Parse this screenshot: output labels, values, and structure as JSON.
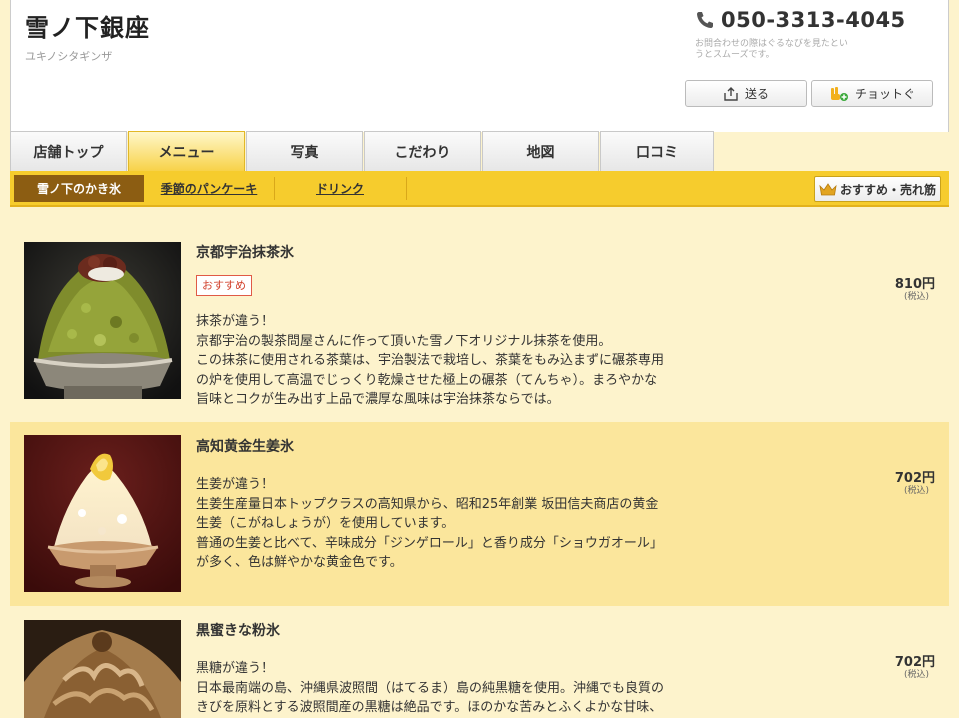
{
  "shop": {
    "name": "雪ノ下銀座",
    "kana": "ユキノシタギンザ",
    "phone": "050-3313-4045",
    "phone_note": "お問合わせの際はぐるなびを見たというとスムーズです。",
    "send_label": "送る",
    "chotto_label": "チョットぐ"
  },
  "tabs": [
    {
      "label": "店舗トップ",
      "active": false
    },
    {
      "label": "メニュー",
      "active": true
    },
    {
      "label": "写真",
      "active": false
    },
    {
      "label": "こだわり",
      "active": false
    },
    {
      "label": "地図",
      "active": false
    },
    {
      "label": "口コミ",
      "active": false
    }
  ],
  "subnav": {
    "items": [
      {
        "label": "雪ノ下のかき氷",
        "active": true
      },
      {
        "label": "季節のパンケーキ",
        "active": false
      },
      {
        "label": "ドリンク",
        "active": false
      }
    ],
    "recommend_label": "おすすめ・売れ筋"
  },
  "menu_items": [
    {
      "name": "京都宇治抹茶氷",
      "badge": "おすすめ",
      "price": "810円",
      "tax": "(税込)",
      "description": [
        "抹茶が違う！",
        "京都宇治の製茶問屋さんに作って頂いた雪ノ下オリジナル抹茶を使用。",
        "この抹茶に使用される茶葉は、宇治製法で栽培し、茶葉をもみ込まずに碾茶専用",
        "の炉を使用して高温でじっくり乾燥させた極上の碾茶（てんちゃ）。まろやかな",
        "旨味とコクが生み出す上品で濃厚な風味は宇治抹茶ならでは。"
      ],
      "image": "matcha-shaved-ice-photo"
    },
    {
      "name": "高知黄金生姜氷",
      "badge": "",
      "price": "702円",
      "tax": "(税込)",
      "description": [
        "生姜が違う！",
        "生姜生産量日本トップクラスの高知県から、昭和25年創業 坂田信夫商店の黄金",
        "生姜（こがねしょうが）を使用しています。",
        "普通の生姜と比べて、辛味成分「ジンゲロール」と香り成分「ショウガオール」",
        "が多く、色は鮮やかな黄金色です。"
      ],
      "image": "ginger-shaved-ice-photo"
    },
    {
      "name": "黒蜜きな粉氷",
      "badge": "",
      "price": "702円",
      "tax": "(税込)",
      "description": [
        "黒糖が違う！",
        "日本最南端の島、沖縄県波照間（はてるま）島の純黒糖を使用。沖縄でも良質の",
        "きびを原料とする波照間産の黒糖は絶品です。ほのかな苦みとふくよかな甘味、"
      ],
      "image": "kuromitsu-kinako-shaved-ice-photo"
    }
  ],
  "colors": {
    "background": "#fdf3cc",
    "tab_active": "#f7d145",
    "subnav": "#f6cc2d",
    "subnav_active": "#8c5d12",
    "alt_row": "#fbe69c",
    "badge": "#d2412c"
  }
}
